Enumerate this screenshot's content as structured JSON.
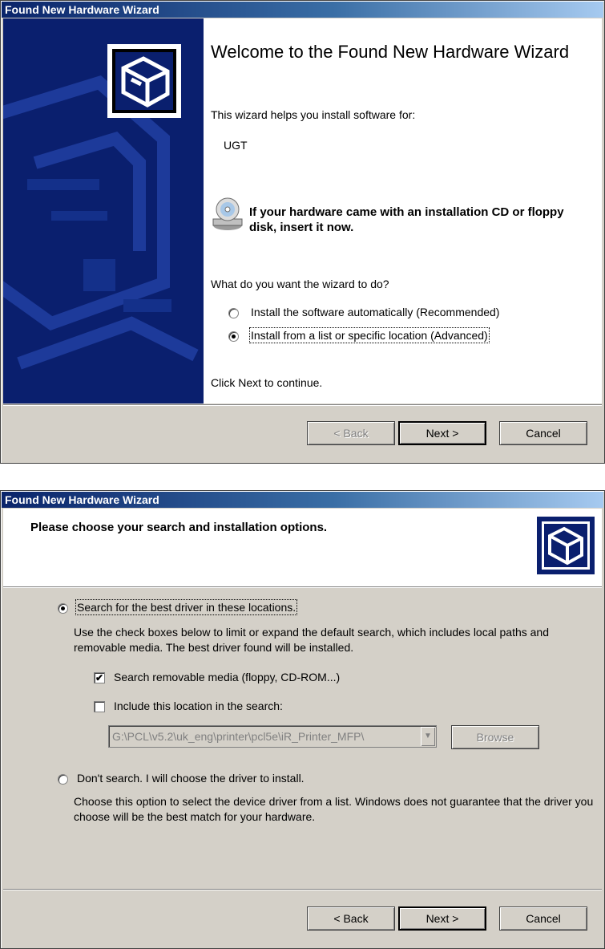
{
  "wizard1": {
    "title": "Found New Hardware Wizard",
    "welcome": "Welcome to the Found New Hardware Wizard",
    "intro": "This wizard helps you install software for:",
    "device": "UGT",
    "cd_prompt": "If your hardware came with an installation CD or floppy disk, insert it now.",
    "question": "What do you want the wizard to do?",
    "option_auto": "Install the software automatically (Recommended)",
    "option_advanced": "Install from a list or specific location (Advanced)",
    "selected_option": "option_advanced",
    "continue_text": "Click Next to continue.",
    "back": "< Back",
    "next": "Next >",
    "cancel": "Cancel"
  },
  "wizard2": {
    "title": "Found New Hardware Wizard",
    "header": "Please choose your search and installation options.",
    "option_search": "Search for the best driver in these locations.",
    "search_desc": "Use the check boxes below to limit or expand the default search, which includes local paths and removable media. The best driver found will be installed.",
    "check_removable": "Search removable media (floppy, CD-ROM...)",
    "check_removable_checked": true,
    "check_location": "Include this location in the search:",
    "check_location_checked": false,
    "location_value": "G:\\PCL\\v5.2\\uk_eng\\printer\\pcl5e\\iR_Printer_MFP\\",
    "browse": "Browse",
    "option_dont_search": "Don't search. I will choose the driver to install.",
    "dont_search_desc": "Choose this option to select the device driver from a list.  Windows does not guarantee that the driver you choose will be the best match for your hardware.",
    "selected_option": "option_search",
    "back": "< Back",
    "next": "Next >",
    "cancel": "Cancel"
  },
  "colors": {
    "titlebar_start": "#0a246a",
    "titlebar_end": "#a6caf0",
    "side_panel": "#0a1f6e",
    "face": "#d4d0c8"
  },
  "icons": [
    "hardware-wizard-icon",
    "cd-drive-icon",
    "hardware-wizard-header-icon",
    "combo-arrow-icon"
  ]
}
